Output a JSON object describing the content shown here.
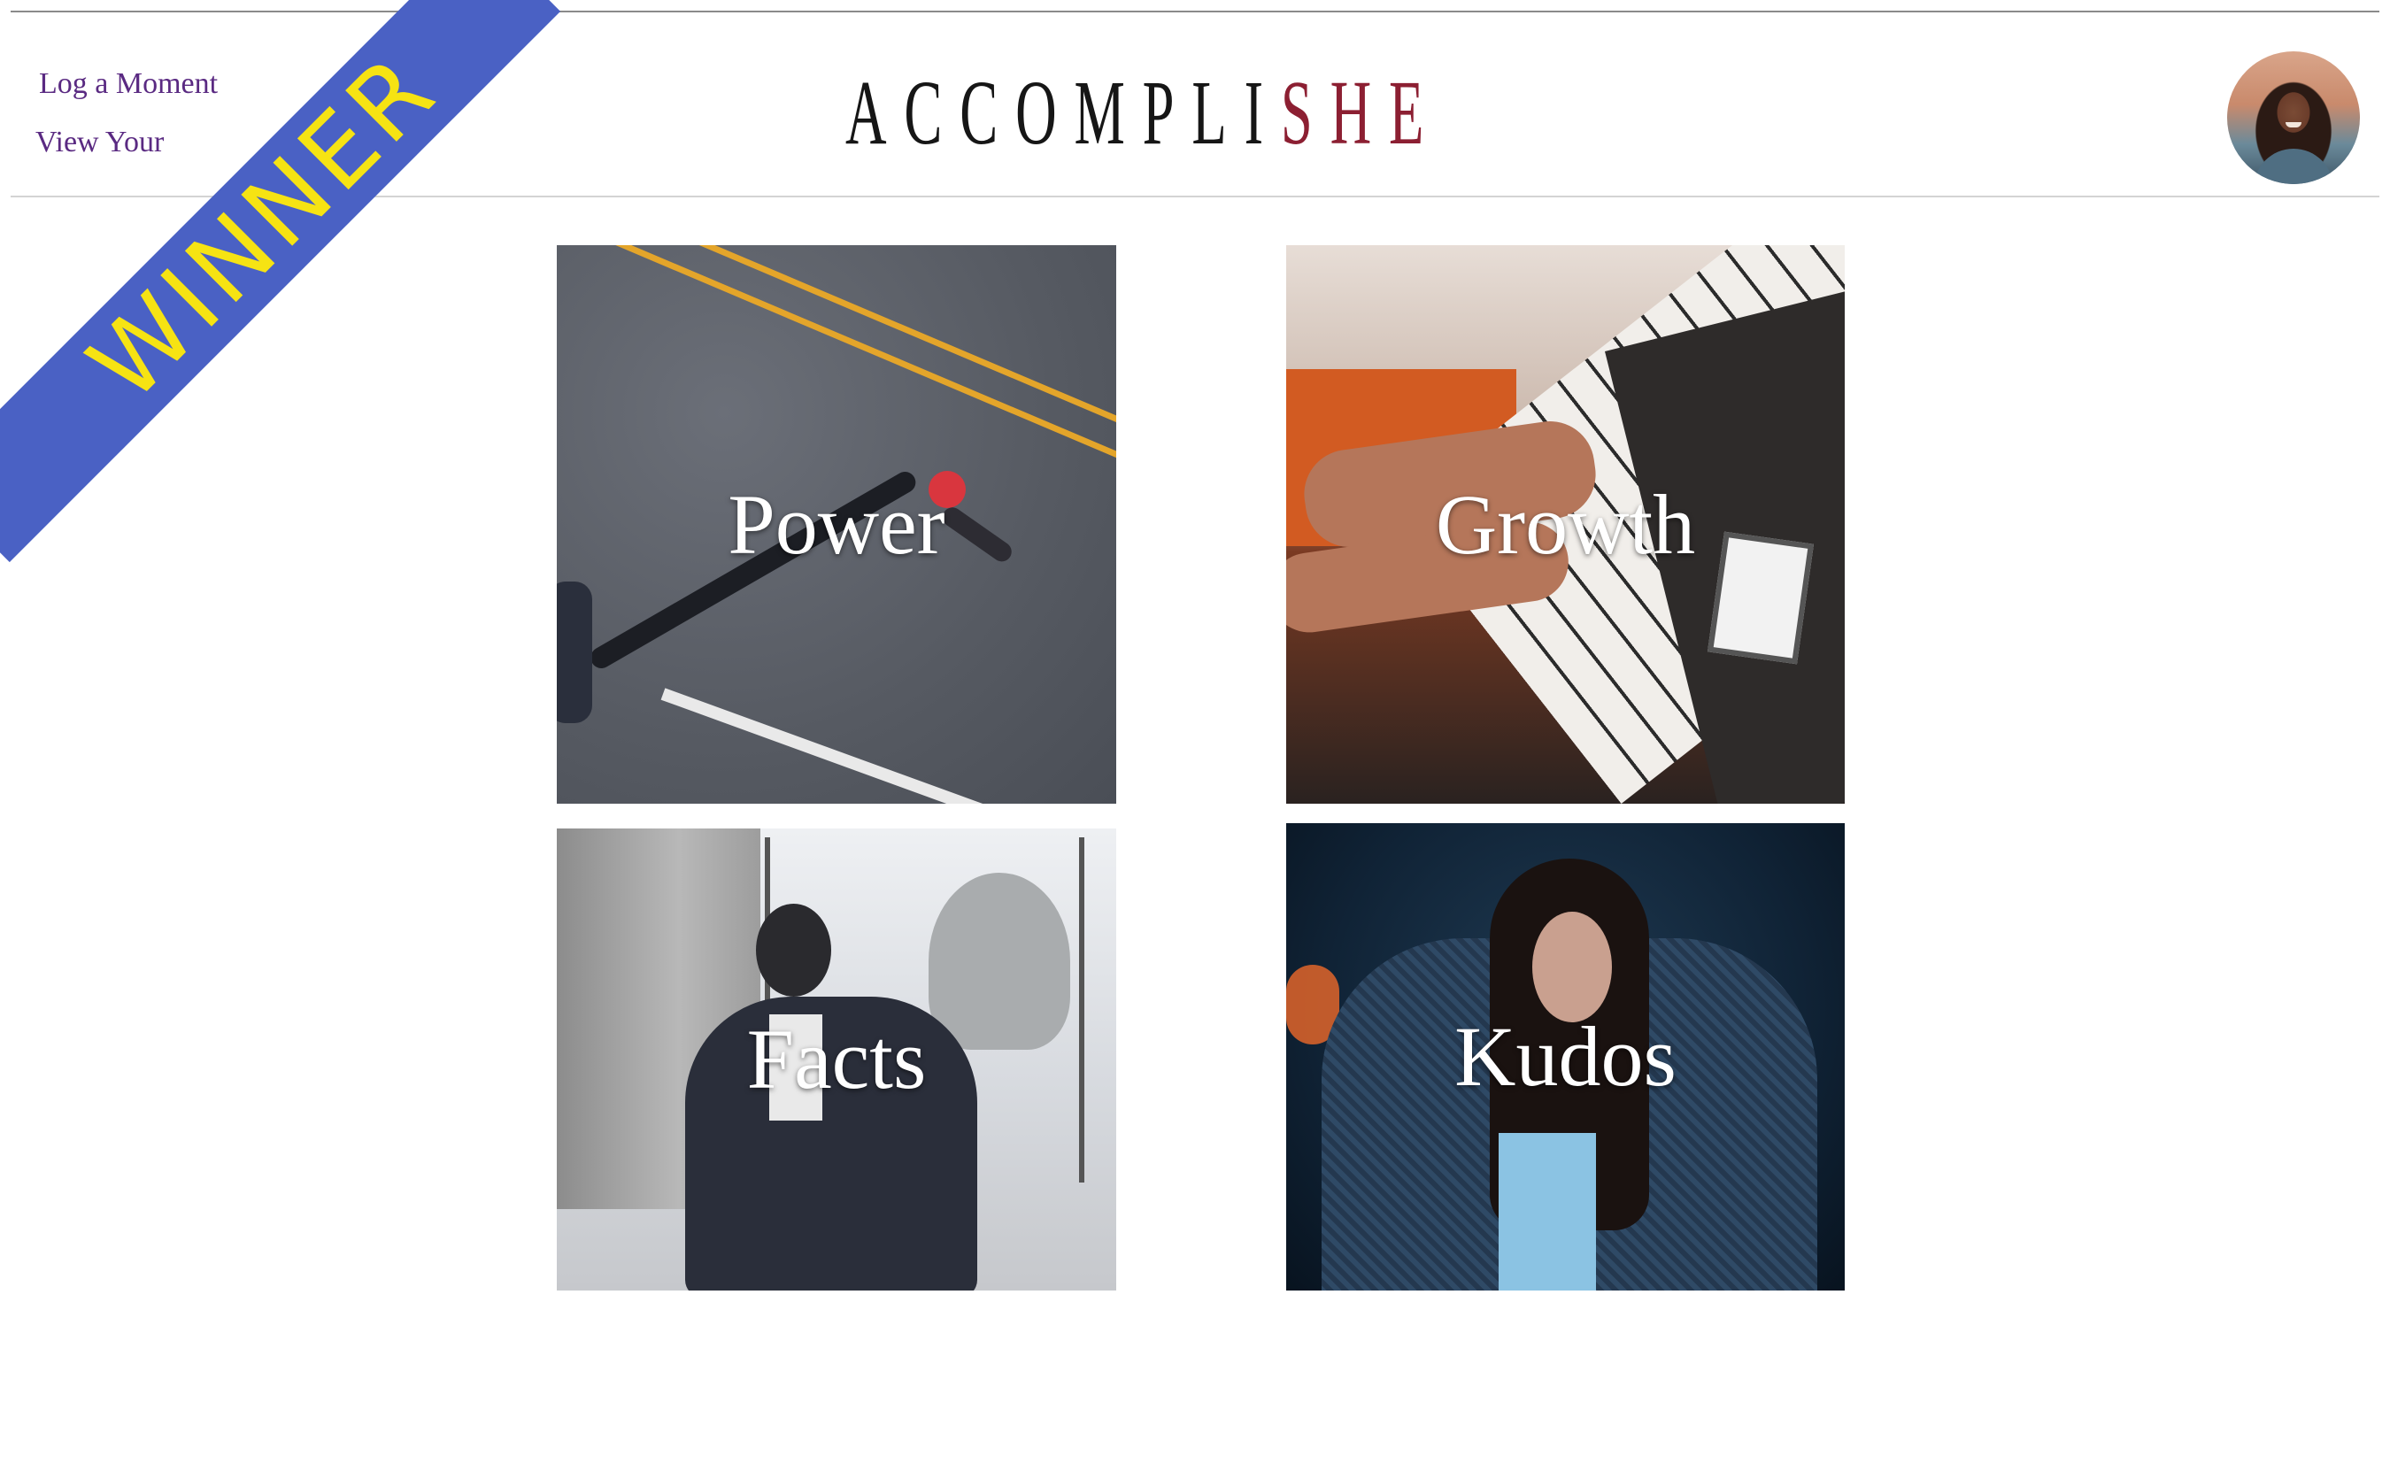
{
  "nav": {
    "links": [
      "Log a Moment",
      "View Your"
    ]
  },
  "header": {
    "logo_main": "ACCOMPLI",
    "logo_accent": "SHE",
    "accent_color": "#8c1f32",
    "avatar_icon": "user-avatar"
  },
  "ribbon": {
    "label": "WINNER",
    "background": "#4a61c4",
    "text_color": "#f6e313"
  },
  "tiles": [
    {
      "label": "Power"
    },
    {
      "label": "Growth"
    },
    {
      "label": "Facts"
    },
    {
      "label": "Kudos"
    }
  ],
  "colors": {
    "nav_link": "#5a2a82",
    "tile_text": "#ffffff"
  }
}
